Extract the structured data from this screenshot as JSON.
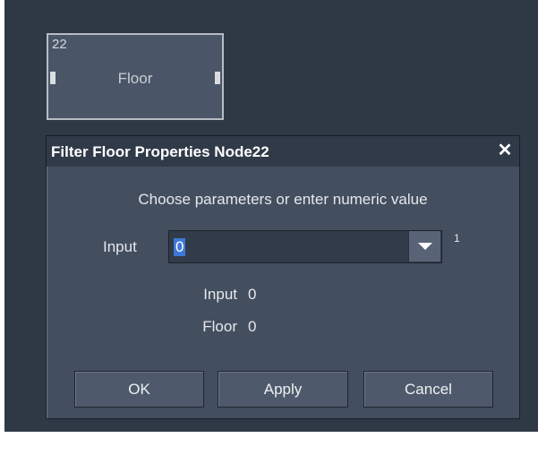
{
  "node": {
    "id": "22",
    "label": "Floor"
  },
  "dialog": {
    "title": "Filter Floor Properties Node22",
    "close_glyph": "✕",
    "prompt": "Choose parameters or enter numeric value",
    "input": {
      "label": "Input",
      "value": "0",
      "index": "1"
    },
    "readouts": [
      {
        "label": "Input",
        "value": "0"
      },
      {
        "label": "Floor",
        "value": "0"
      }
    ],
    "buttons": {
      "ok": "OK",
      "apply": "Apply",
      "cancel": "Cancel"
    }
  },
  "colors": {
    "canvas": "#2f3845",
    "dialog_bg": "#434e5f",
    "titlebar": "#303a48",
    "selection": "#3d78d8"
  },
  "icons": {
    "close": "close-icon",
    "dropdown": "chevron-down-icon"
  }
}
